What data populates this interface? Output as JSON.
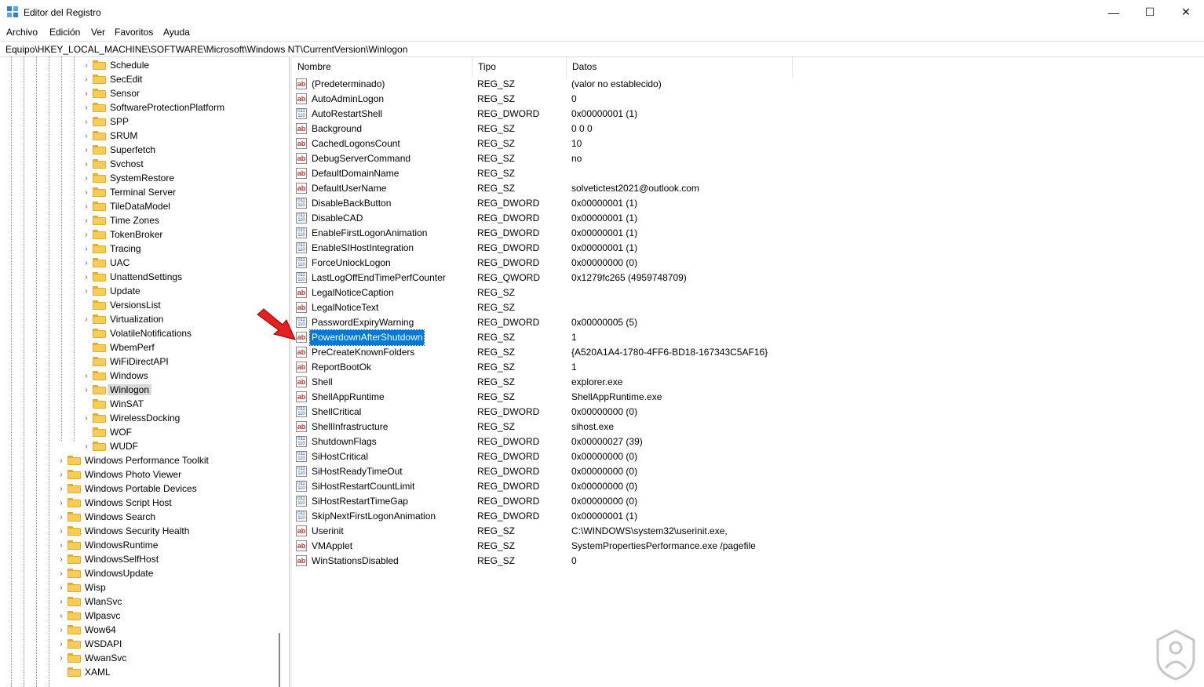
{
  "window": {
    "title": "Editor del Registro",
    "minimize": "—",
    "maximize": "☐",
    "close": "✕"
  },
  "menu": [
    "Archivo",
    "Edición",
    "Ver",
    "Favoritos",
    "Ayuda"
  ],
  "address": "Equipo\\HKEY_LOCAL_MACHINE\\SOFTWARE\\Microsoft\\Windows NT\\CurrentVersion\\Winlogon",
  "tree": {
    "inner_items": [
      {
        "label": "Schedule",
        "expandable": true
      },
      {
        "label": "SecEdit",
        "expandable": true
      },
      {
        "label": "Sensor",
        "expandable": true
      },
      {
        "label": "SoftwareProtectionPlatform",
        "expandable": true
      },
      {
        "label": "SPP",
        "expandable": true
      },
      {
        "label": "SRUM",
        "expandable": true
      },
      {
        "label": "Superfetch",
        "expandable": true
      },
      {
        "label": "Svchost",
        "expandable": true
      },
      {
        "label": "SystemRestore",
        "expandable": true
      },
      {
        "label": "Terminal Server",
        "expandable": true
      },
      {
        "label": "TileDataModel",
        "expandable": true
      },
      {
        "label": "Time Zones",
        "expandable": true
      },
      {
        "label": "TokenBroker",
        "expandable": true
      },
      {
        "label": "Tracing",
        "expandable": true
      },
      {
        "label": "UAC",
        "expandable": true
      },
      {
        "label": "UnattendSettings",
        "expandable": true
      },
      {
        "label": "Update",
        "expandable": true
      },
      {
        "label": "VersionsList",
        "expandable": false
      },
      {
        "label": "Virtualization",
        "expandable": true
      },
      {
        "label": "VolatileNotifications",
        "expandable": false
      },
      {
        "label": "WbemPerf",
        "expandable": false
      },
      {
        "label": "WiFiDirectAPI",
        "expandable": false
      },
      {
        "label": "Windows",
        "expandable": true
      },
      {
        "label": "Winlogon",
        "expandable": true,
        "selected": true
      },
      {
        "label": "WinSAT",
        "expandable": false
      },
      {
        "label": "WirelessDocking",
        "expandable": true
      },
      {
        "label": "WOF",
        "expandable": false
      },
      {
        "label": "WUDF",
        "expandable": true
      }
    ],
    "outer_items": [
      {
        "label": "Windows Performance Toolkit",
        "expandable": true
      },
      {
        "label": "Windows Photo Viewer",
        "expandable": true
      },
      {
        "label": "Windows Portable Devices",
        "expandable": true
      },
      {
        "label": "Windows Script Host",
        "expandable": true
      },
      {
        "label": "Windows Search",
        "expandable": true
      },
      {
        "label": "Windows Security Health",
        "expandable": true
      },
      {
        "label": "WindowsRuntime",
        "expandable": true
      },
      {
        "label": "WindowsSelfHost",
        "expandable": true
      },
      {
        "label": "WindowsUpdate",
        "expandable": true
      },
      {
        "label": "Wisp",
        "expandable": true
      },
      {
        "label": "WlanSvc",
        "expandable": true
      },
      {
        "label": "Wlpasvc",
        "expandable": true
      },
      {
        "label": "Wow64",
        "expandable": true
      },
      {
        "label": "WSDAPI",
        "expandable": true
      },
      {
        "label": "WwanSvc",
        "expandable": true
      },
      {
        "label": "XAML",
        "expandable": false
      }
    ]
  },
  "list": {
    "headers": {
      "name": "Nombre",
      "type": "Tipo",
      "data": "Datos"
    },
    "rows": [
      {
        "name": "(Predeterminado)",
        "type": "REG_SZ",
        "data": "(valor no establecido)",
        "icon": "string-value-icon"
      },
      {
        "name": "AutoAdminLogon",
        "type": "REG_SZ",
        "data": "0",
        "icon": "string-value-icon"
      },
      {
        "name": "AutoRestartShell",
        "type": "REG_DWORD",
        "data": "0x00000001 (1)",
        "icon": "binary-value-icon"
      },
      {
        "name": "Background",
        "type": "REG_SZ",
        "data": "0 0 0",
        "icon": "string-value-icon"
      },
      {
        "name": "CachedLogonsCount",
        "type": "REG_SZ",
        "data": "10",
        "icon": "string-value-icon"
      },
      {
        "name": "DebugServerCommand",
        "type": "REG_SZ",
        "data": "no",
        "icon": "string-value-icon"
      },
      {
        "name": "DefaultDomainName",
        "type": "REG_SZ",
        "data": "",
        "icon": "string-value-icon"
      },
      {
        "name": "DefaultUserName",
        "type": "REG_SZ",
        "data": "solvetictest2021@outlook.com",
        "icon": "string-value-icon"
      },
      {
        "name": "DisableBackButton",
        "type": "REG_DWORD",
        "data": "0x00000001 (1)",
        "icon": "binary-value-icon"
      },
      {
        "name": "DisableCAD",
        "type": "REG_DWORD",
        "data": "0x00000001 (1)",
        "icon": "binary-value-icon"
      },
      {
        "name": "EnableFirstLogonAnimation",
        "type": "REG_DWORD",
        "data": "0x00000001 (1)",
        "icon": "binary-value-icon"
      },
      {
        "name": "EnableSIHostIntegration",
        "type": "REG_DWORD",
        "data": "0x00000001 (1)",
        "icon": "binary-value-icon"
      },
      {
        "name": "ForceUnlockLogon",
        "type": "REG_DWORD",
        "data": "0x00000000 (0)",
        "icon": "binary-value-icon"
      },
      {
        "name": "LastLogOffEndTimePerfCounter",
        "type": "REG_QWORD",
        "data": "0x1279fc265 (4959748709)",
        "icon": "binary-value-icon"
      },
      {
        "name": "LegalNoticeCaption",
        "type": "REG_SZ",
        "data": "",
        "icon": "string-value-icon"
      },
      {
        "name": "LegalNoticeText",
        "type": "REG_SZ",
        "data": "",
        "icon": "string-value-icon"
      },
      {
        "name": "PasswordExpiryWarning",
        "type": "REG_DWORD",
        "data": "0x00000005 (5)",
        "icon": "binary-value-icon"
      },
      {
        "name": "PowerdownAfterShutdown",
        "type": "REG_SZ",
        "data": "1",
        "icon": "string-value-icon",
        "selected": true
      },
      {
        "name": "PreCreateKnownFolders",
        "type": "REG_SZ",
        "data": "{A520A1A4-1780-4FF6-BD18-167343C5AF16}",
        "icon": "string-value-icon"
      },
      {
        "name": "ReportBootOk",
        "type": "REG_SZ",
        "data": "1",
        "icon": "string-value-icon"
      },
      {
        "name": "Shell",
        "type": "REG_SZ",
        "data": "explorer.exe",
        "icon": "string-value-icon"
      },
      {
        "name": "ShellAppRuntime",
        "type": "REG_SZ",
        "data": "ShellAppRuntime.exe",
        "icon": "string-value-icon"
      },
      {
        "name": "ShellCritical",
        "type": "REG_DWORD",
        "data": "0x00000000 (0)",
        "icon": "binary-value-icon"
      },
      {
        "name": "ShellInfrastructure",
        "type": "REG_SZ",
        "data": "sihost.exe",
        "icon": "string-value-icon"
      },
      {
        "name": "ShutdownFlags",
        "type": "REG_DWORD",
        "data": "0x00000027 (39)",
        "icon": "binary-value-icon"
      },
      {
        "name": "SiHostCritical",
        "type": "REG_DWORD",
        "data": "0x00000000 (0)",
        "icon": "binary-value-icon"
      },
      {
        "name": "SiHostReadyTimeOut",
        "type": "REG_DWORD",
        "data": "0x00000000 (0)",
        "icon": "binary-value-icon"
      },
      {
        "name": "SiHostRestartCountLimit",
        "type": "REG_DWORD",
        "data": "0x00000000 (0)",
        "icon": "binary-value-icon"
      },
      {
        "name": "SiHostRestartTimeGap",
        "type": "REG_DWORD",
        "data": "0x00000000 (0)",
        "icon": "binary-value-icon"
      },
      {
        "name": "SkipNextFirstLogonAnimation",
        "type": "REG_DWORD",
        "data": "0x00000001 (1)",
        "icon": "binary-value-icon"
      },
      {
        "name": "Userinit",
        "type": "REG_SZ",
        "data": "C:\\WINDOWS\\system32\\userinit.exe,",
        "icon": "string-value-icon"
      },
      {
        "name": "VMApplet",
        "type": "REG_SZ",
        "data": "SystemPropertiesPerformance.exe /pagefile",
        "icon": "string-value-icon"
      },
      {
        "name": "WinStationsDisabled",
        "type": "REG_SZ",
        "data": "0",
        "icon": "string-value-icon"
      }
    ]
  },
  "colors": {
    "selection": "#0078d7",
    "arrow": "#e62020",
    "folder": "#f9cd55"
  }
}
